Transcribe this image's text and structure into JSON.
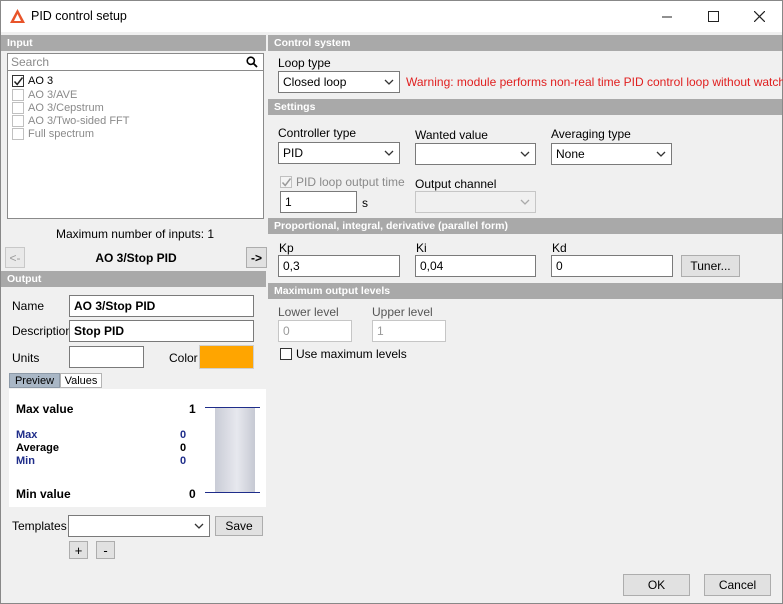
{
  "window": {
    "title": "PID control setup"
  },
  "input_panel": {
    "header": "Input",
    "search_placeholder": "Search",
    "items": [
      {
        "label": "AO 3",
        "checked": true,
        "enabled": true
      },
      {
        "label": "AO 3/AVE",
        "checked": false,
        "enabled": false
      },
      {
        "label": "AO 3/Cepstrum",
        "checked": false,
        "enabled": false
      },
      {
        "label": "AO 3/Two-sided FFT",
        "checked": false,
        "enabled": false
      },
      {
        "label": "Full spectrum",
        "checked": false,
        "enabled": false
      }
    ],
    "max_inputs_text": "Maximum number of inputs: 1",
    "prev_label": "<-",
    "next_label": "->",
    "current_name": "AO 3/Stop PID"
  },
  "output_panel": {
    "header": "Output",
    "name_label": "Name",
    "name_value": "AO 3/Stop PID",
    "description_label": "Description",
    "description_value": "Stop PID",
    "units_label": "Units",
    "units_value": "",
    "color_label": "Color",
    "color_value": "#FFA500",
    "tabs": [
      "Preview",
      "Values"
    ],
    "preview": {
      "max_value_label": "Max value",
      "max_value": "1",
      "max_label": "Max",
      "max": "0",
      "average_label": "Average",
      "average": "0",
      "min_label": "Min",
      "min": "0",
      "min_value_label": "Min value",
      "min_value": "0"
    },
    "templates_label": "Templates",
    "templates_value": "",
    "save_label": "Save",
    "add_label": "+",
    "remove_label": "-"
  },
  "control_system": {
    "header": "Control system",
    "loop_type_label": "Loop type",
    "loop_type_value": "Closed loop",
    "warning": "Warning: module performs non-real time PID control loop without watchdog."
  },
  "settings": {
    "header": "Settings",
    "controller_type_label": "Controller type",
    "controller_type_value": "PID",
    "wanted_value_label": "Wanted value",
    "wanted_value": "",
    "averaging_type_label": "Averaging type",
    "averaging_type_value": "None",
    "pid_loop_output_time_label": "PID loop output time",
    "pid_loop_output_time_value": "1",
    "pid_loop_output_time_unit": "s",
    "output_channel_label": "Output channel",
    "output_channel_value": ""
  },
  "pid": {
    "header": "Proportional, integral, derivative (parallel form)",
    "kp_label": "Kp",
    "kp_value": "0,3",
    "ki_label": "Ki",
    "ki_value": "0,04",
    "kd_label": "Kd",
    "kd_value": "0",
    "tuner_label": "Tuner..."
  },
  "max_output": {
    "header": "Maximum output levels",
    "lower_label": "Lower level",
    "lower_value": "0",
    "upper_label": "Upper level",
    "upper_value": "1",
    "use_max_label": "Use maximum levels"
  },
  "footer": {
    "ok_label": "OK",
    "cancel_label": "Cancel"
  },
  "colors": {
    "section_header": "#A9A9A9",
    "warning": "#E02020",
    "stat_blue": "#1F2D8A"
  },
  "icons": [
    "app-logo-icon",
    "minimize-icon",
    "maximize-icon",
    "close-icon",
    "search-icon",
    "chevron-down-icon",
    "checkbox-check-icon"
  ]
}
